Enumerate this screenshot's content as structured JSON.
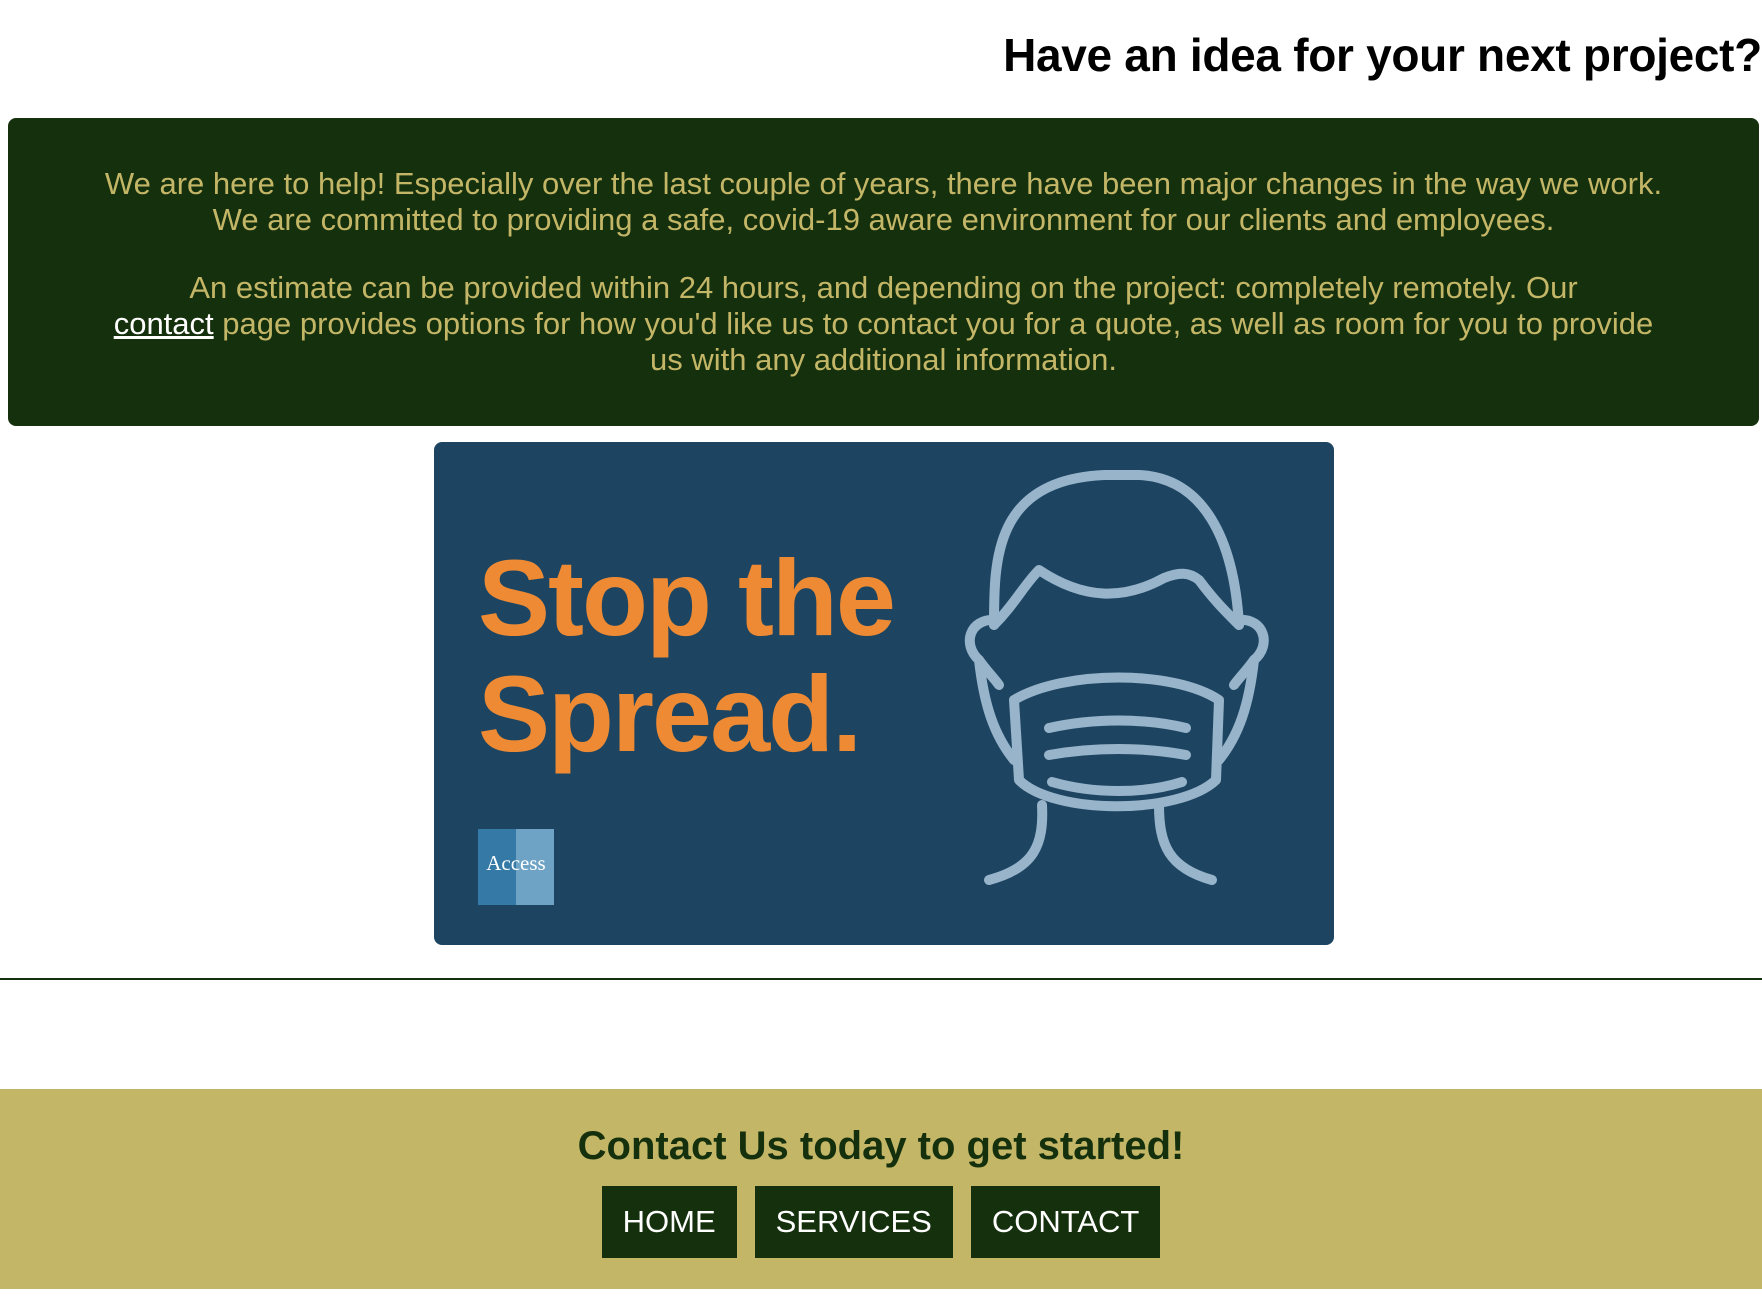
{
  "header": {
    "title": "Have an idea for your next project?"
  },
  "info": {
    "paragraph1": "We are here to help! Especially over the last couple of years, there have been major changes in the way we work. We are committed to providing a safe, covid-19 aware environment for our clients and employees.",
    "paragraph2_before": "An estimate can be provided within 24 hours, and depending on the project: completely remotely. Our",
    "paragraph2_link": "contact",
    "paragraph2_after": "page provides options for how you'd like us to contact you for a quote, as well as room for you to provide us with any additional information."
  },
  "banner": {
    "headline_line1": "Stop the",
    "headline_line2": "Spread.",
    "logo_text": "Access",
    "icon": "face-mask-icon"
  },
  "footer": {
    "heading": "Contact Us today to get started!",
    "nav": [
      {
        "label": "HOME"
      },
      {
        "label": "SERVICES"
      },
      {
        "label": "CONTACT"
      }
    ]
  },
  "colors": {
    "dark_green": "#15300d",
    "gold": "#c4b667",
    "banner_blue": "#1d4562",
    "banner_orange": "#ee8a33",
    "mask_outline": "#98b4ca"
  }
}
